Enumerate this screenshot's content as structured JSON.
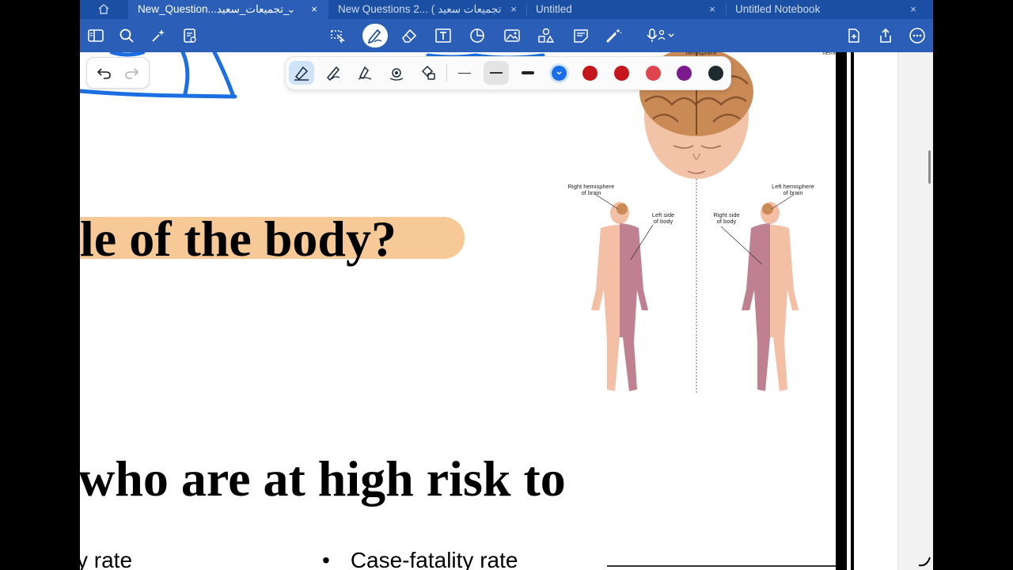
{
  "tabs": [
    {
      "label": "New_Question...تجميعات_سعيد_",
      "active": true
    },
    {
      "label": "New Questions 2... ( تجميعات سعيد",
      "active": false
    },
    {
      "label": "Untitled",
      "active": false
    },
    {
      "label": "Untitled Notebook",
      "active": false
    }
  ],
  "page": {
    "heading_partial_1": "le of the body?",
    "heading_partial_2": "who are at high risk to",
    "bullet_left": "y rate",
    "bullet_right": "Case-fatality rate",
    "bullet_symbol": "•"
  },
  "figure": {
    "top_label_left": "hemisphere",
    "top_label_right": "hemisphere",
    "right_hemisphere_label": "Right hemisphere\nof brain",
    "left_side_label": "Left side\nof body",
    "left_hemisphere_label": "Left hemisphere\nof brain",
    "right_side_label": "Right side\nof body"
  },
  "colors": {
    "tabbar_bg": "#1b4fa3",
    "toolbar_bg": "#2b5fb7",
    "highlight": "#f7c996",
    "ink_blue": "#1b6fe0",
    "swatches": [
      "#1c6ee8",
      "#c4161c",
      "#c4161c",
      "#e0444f",
      "#7a1a8c",
      "#1f2a2e"
    ]
  },
  "icons": {
    "toolbar_left": [
      "sidebar-icon",
      "search-icon",
      "sparkle-icon",
      "doc-settings-icon"
    ],
    "toolbar_center": [
      "lasso-icon",
      "pen-icon",
      "eraser-icon",
      "text-box-icon",
      "shapes-icon",
      "image-icon",
      "elements-icon",
      "sticky-note-icon",
      "laser-pointer-icon",
      "record-audio-icon"
    ],
    "toolbar_right": [
      "add-page-icon",
      "share-icon",
      "more-icon"
    ],
    "pen_types": [
      "fountain-pen-icon",
      "ball-pen-icon",
      "brush-pen-icon",
      "pen-settings-icon",
      "color-picker-icon"
    ]
  }
}
